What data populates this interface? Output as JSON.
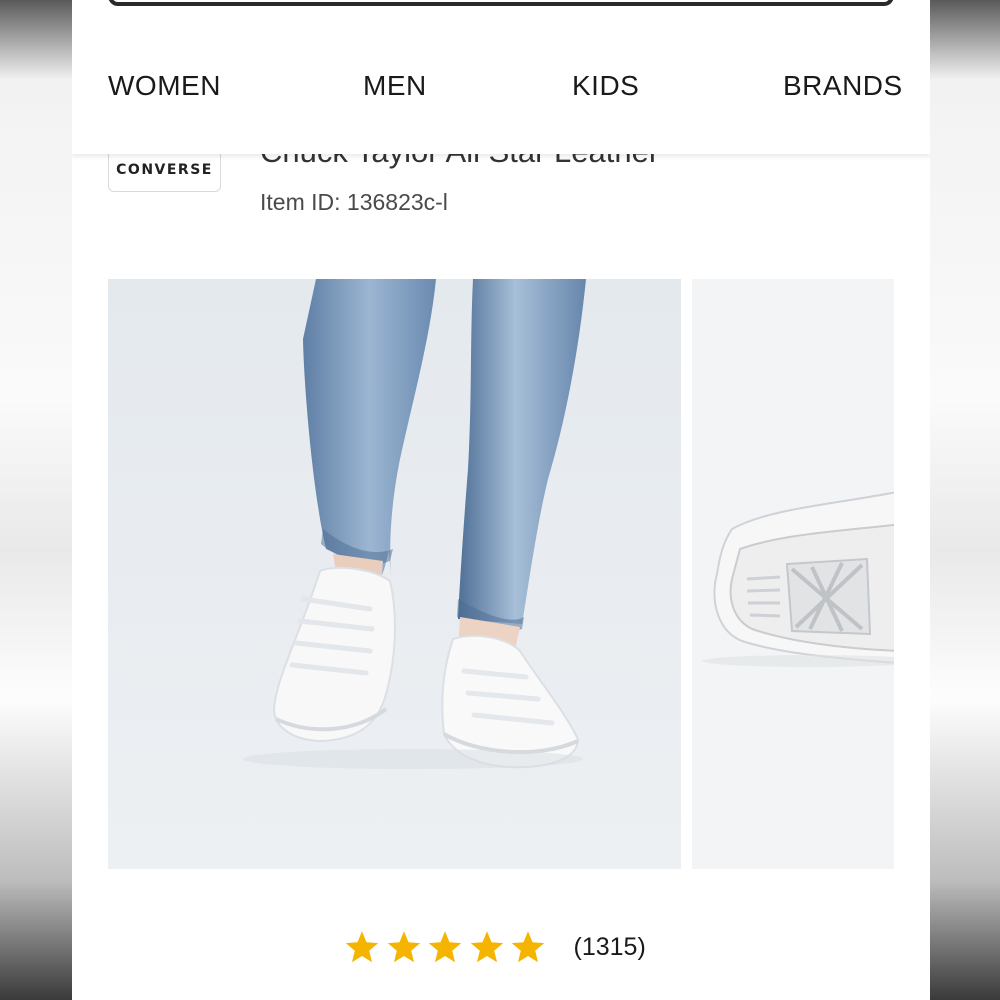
{
  "nav": {
    "items": [
      {
        "label": "WOMEN"
      },
      {
        "label": "MEN"
      },
      {
        "label": "KIDS"
      },
      {
        "label": "BRANDS"
      }
    ]
  },
  "product": {
    "brand_logo_text": "CONVERSE",
    "title": "Chuck Taylor All Star Leather",
    "item_id": "Item ID: 136823c-l"
  },
  "rating": {
    "stars": 5,
    "max_stars": 5,
    "count": "(1315)",
    "star_color": "#f5b400"
  },
  "colors": {
    "photo_bg": "#e6ebef",
    "denim": "#7b9cc0",
    "sneaker": "#f7f7f7"
  }
}
